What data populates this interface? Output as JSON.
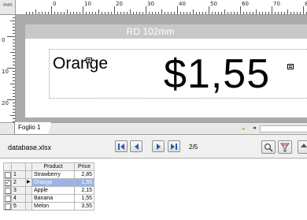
{
  "ruler": {
    "unit": "mm",
    "h_labels": [
      "0",
      "10",
      "20",
      "30",
      "40",
      "50",
      "60",
      "70",
      "80"
    ],
    "v_labels": [
      "0",
      "10",
      "20"
    ]
  },
  "canvas": {
    "media_label": "RD 102mm",
    "product_text": "Orange",
    "price_text": "$1,55"
  },
  "sheet": {
    "tab_label": "Foglio 1"
  },
  "database": {
    "file_name": "database.xlsx",
    "record_position": "2/5",
    "columns": [
      "Product",
      "Price"
    ],
    "rows": [
      {
        "num": "1",
        "checked": false,
        "current": false,
        "product": "Strawberry",
        "price": "2,85"
      },
      {
        "num": "2",
        "checked": true,
        "current": true,
        "product": "Orange",
        "price": "1,55"
      },
      {
        "num": "3",
        "checked": false,
        "current": false,
        "product": "Apple",
        "price": "2,15"
      },
      {
        "num": "4",
        "checked": false,
        "current": false,
        "product": "Banana",
        "price": "1,55"
      },
      {
        "num": "5",
        "checked": false,
        "current": false,
        "product": "Melon",
        "price": "3,55"
      }
    ]
  },
  "colors": {
    "canvas_bg": "#ababab",
    "selection": "#99b4e8",
    "nav_arrow": "#2a5bb8"
  },
  "icons": {
    "first": "first-record-icon",
    "prev": "previous-record-icon",
    "next": "next-record-icon",
    "last": "last-record-icon",
    "search": "search-icon",
    "filter": "filter-icon"
  }
}
